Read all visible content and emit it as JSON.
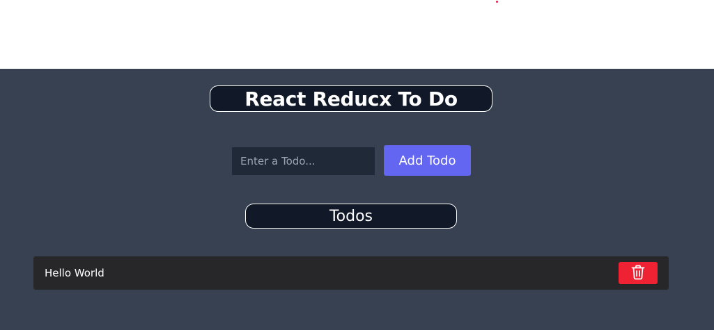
{
  "header": {
    "title": "React Reducx To Do"
  },
  "form": {
    "input_value": "",
    "input_placeholder": "Enter a Todo...",
    "add_label": "Add Todo"
  },
  "list": {
    "heading": "Todos",
    "items": [
      {
        "text": "Hello World",
        "delete_icon": "trash-icon"
      }
    ]
  },
  "colors": {
    "app_background": "#374151",
    "header_box": "#111827",
    "input_background": "#1f2937",
    "add_button": "#6366f1",
    "todo_item_background": "#27272a",
    "delete_button": "#ef2233"
  }
}
